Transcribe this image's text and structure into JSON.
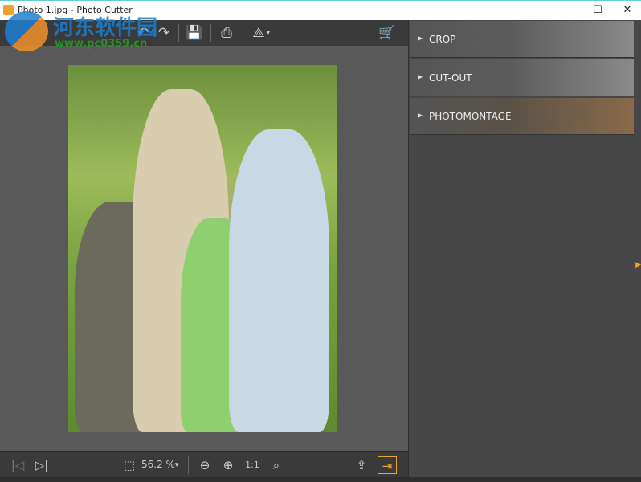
{
  "window": {
    "title": "Photo 1.jpg - Photo Cutter",
    "minimize": "—",
    "maximize": "☐",
    "close": "✕"
  },
  "watermark": {
    "text": "河东软件园",
    "url": "www.pc0359.cn"
  },
  "toolbar": {
    "undo": "↶",
    "redo": "↷",
    "save": "💾",
    "print": "⎙",
    "share": "⟁",
    "share_caret": "▾",
    "cart": "🛒"
  },
  "bottombar": {
    "first": "|◁",
    "next": "▷|",
    "fit": "⬚",
    "zoom": "56.2 %",
    "zoom_caret": "▾",
    "zoom_out": "⊖",
    "zoom_in": "⊕",
    "actual": "1:1",
    "zoom_fit": "⌕",
    "export": "⇪",
    "panel_toggle": "⇥"
  },
  "side": {
    "panels": [
      {
        "label": "CROP",
        "arrow": "▶"
      },
      {
        "label": "CUT-OUT",
        "arrow": "▶"
      },
      {
        "label": "PHOTOMONTAGE",
        "arrow": "▶"
      }
    ],
    "handle": "▶"
  },
  "colors": {
    "accent": "#f0a030",
    "toolbar": "#3a3a3a",
    "canvas": "#595959",
    "panel": "#474747"
  }
}
